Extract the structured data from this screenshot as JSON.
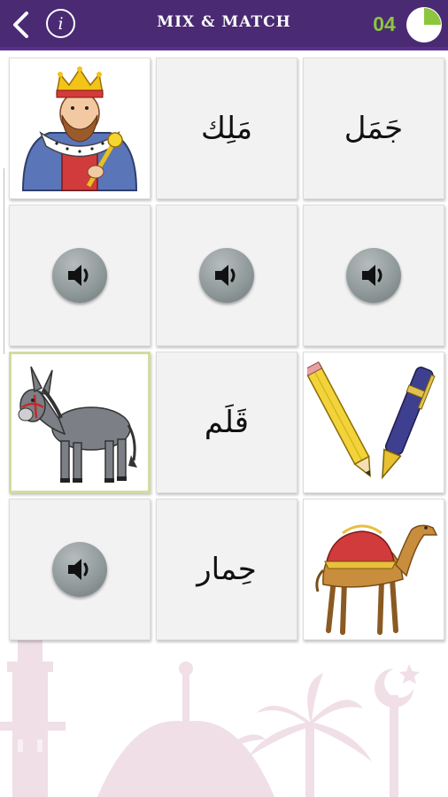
{
  "header": {
    "title": "MIX & MATCH",
    "counter": "04",
    "timer_fraction_remaining": 0.75
  },
  "colors": {
    "header_bg": "#4a2a73",
    "counter": "#8cc63f",
    "timer_fill": "#8cc63f",
    "selected_border": "#d3dca0",
    "decoration": "#ead6e0"
  },
  "tiles": [
    {
      "type": "image",
      "subject": "king"
    },
    {
      "type": "word",
      "text": "مَلِك"
    },
    {
      "type": "word",
      "text": "جَمَل"
    },
    {
      "type": "audio",
      "icon": "speaker-icon"
    },
    {
      "type": "audio",
      "icon": "speaker-icon"
    },
    {
      "type": "audio",
      "icon": "speaker-icon"
    },
    {
      "type": "image",
      "subject": "donkey",
      "selected": true
    },
    {
      "type": "word",
      "text": "قَلَم"
    },
    {
      "type": "image",
      "subject": "pencil-and-pen"
    },
    {
      "type": "audio",
      "icon": "speaker-icon"
    },
    {
      "type": "word",
      "text": "حِمار"
    },
    {
      "type": "image",
      "subject": "camel"
    }
  ]
}
